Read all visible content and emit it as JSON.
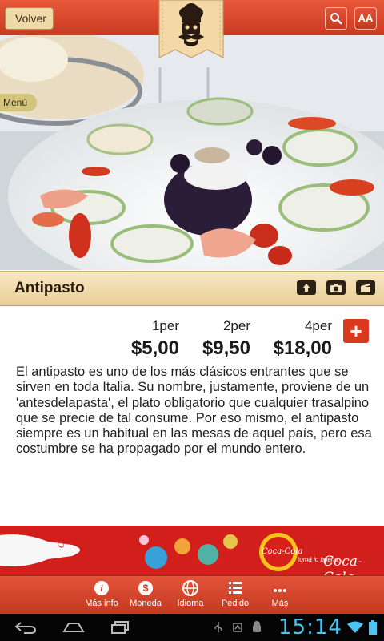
{
  "header": {
    "back_label": "Volver",
    "search_icon": "search-icon",
    "text_size_label": "AA"
  },
  "hero": {
    "menu_tab_label": "Menú"
  },
  "dish": {
    "title": "Antipasto",
    "actions": [
      "share-icon",
      "camera-icon",
      "clapper-icon"
    ],
    "prices": [
      {
        "label": "1per",
        "value": "$5,00"
      },
      {
        "label": "2per",
        "value": "$9,50"
      },
      {
        "label": "4per",
        "value": "$18,00"
      }
    ],
    "add_label": "+",
    "description": "El antipasto es uno de los más clásicos entrantes que se sirven en toda Italia. Su nombre, justamente, proviene de un 'antesdelapasta', el plato obligatorio que cualquier trasalpino que se precie de tal consume. Por eso mismo, el antipasto siempre es un habitual en las mesas de aquel país, pero esa costumbre se ha propagado por el mundo entero."
  },
  "ad": {
    "brand": "Coca-Cola",
    "slogan": "tomá lo bueno"
  },
  "bottom_nav": [
    {
      "label": "Más info",
      "icon": "info-icon"
    },
    {
      "label": "Moneda",
      "icon": "currency-icon"
    },
    {
      "label": "Idioma",
      "icon": "globe-icon"
    },
    {
      "label": "Pedido",
      "icon": "list-icon"
    },
    {
      "label": "Más",
      "icon": "more-icon"
    }
  ],
  "system_bar": {
    "time": "15:14"
  },
  "colors": {
    "brand_red": "#d93a1f",
    "title_bar": "#f2dcae",
    "clock_blue": "#4cc3f1"
  }
}
